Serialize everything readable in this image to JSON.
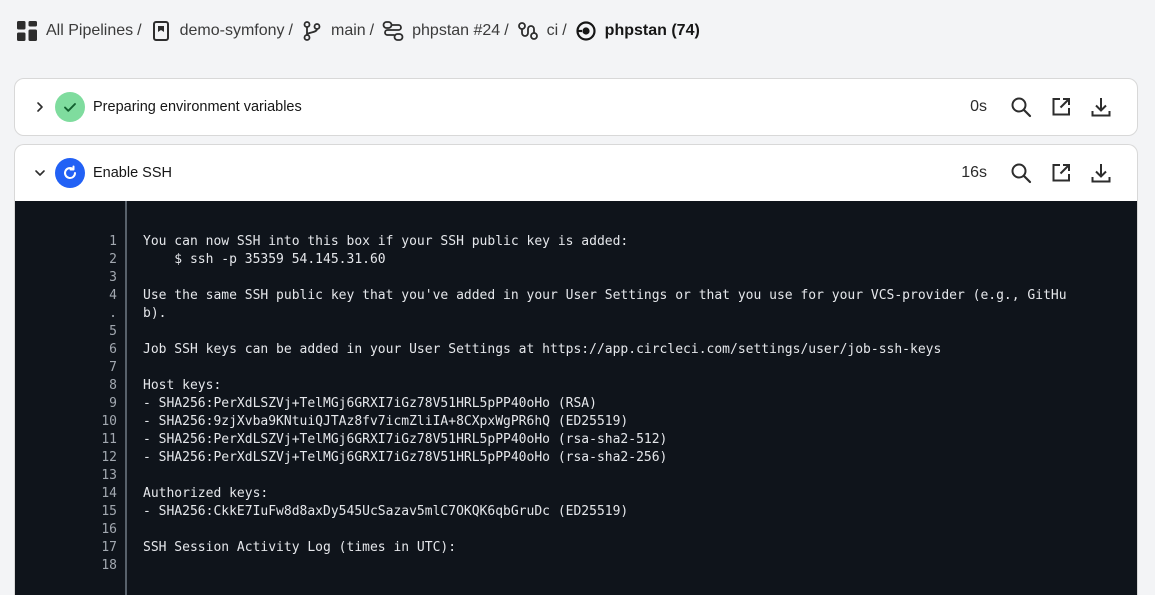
{
  "breadcrumb": {
    "items": [
      {
        "label": "All Pipelines",
        "sep": "/"
      },
      {
        "label": "demo-symfony",
        "sep": "/"
      },
      {
        "label": "main",
        "sep": "/"
      },
      {
        "label": "phpstan #24",
        "sep": "/"
      },
      {
        "label": "ci",
        "sep": "/"
      },
      {
        "label": "phpstan (74)"
      }
    ]
  },
  "steps": [
    {
      "title": "Preparing environment variables",
      "duration": "0s",
      "status": "success"
    },
    {
      "title": "Enable SSH",
      "duration": "16s",
      "status": "running"
    }
  ],
  "terminal": {
    "lines": [
      {
        "num": "1",
        "text": "You can now SSH into this box if your SSH public key is added:"
      },
      {
        "num": "2",
        "text": "    $ ssh -p 35359 54.145.31.60"
      },
      {
        "num": "3",
        "text": ""
      },
      {
        "num": "4",
        "text": "Use the same SSH public key that you've added in your User Settings or that you use for your VCS-provider (e.g., GitHu"
      },
      {
        "num": ".",
        "text": "b)."
      },
      {
        "num": "5",
        "text": ""
      },
      {
        "num": "6",
        "text": "Job SSH keys can be added in your User Settings at https://app.circleci.com/settings/user/job-ssh-keys"
      },
      {
        "num": "7",
        "text": ""
      },
      {
        "num": "8",
        "text": "Host keys:"
      },
      {
        "num": "9",
        "text": "- SHA256:PerXdLSZVj+TelMGj6GRXI7iGz78V51HRL5pPP40oHo (RSA)"
      },
      {
        "num": "10",
        "text": "- SHA256:9zjXvba9KNtuiQJTAz8fv7icmZliIA+8CXpxWgPR6hQ (ED25519)"
      },
      {
        "num": "11",
        "text": "- SHA256:PerXdLSZVj+TelMGj6GRXI7iGz78V51HRL5pPP40oHo (rsa-sha2-512)"
      },
      {
        "num": "12",
        "text": "- SHA256:PerXdLSZVj+TelMGj6GRXI7iGz78V51HRL5pPP40oHo (rsa-sha2-256)"
      },
      {
        "num": "13",
        "text": ""
      },
      {
        "num": "14",
        "text": "Authorized keys:"
      },
      {
        "num": "15",
        "text": "- SHA256:CkkE7IuFw8d8axDy545UcSazav5mlC7OKQK6qbGruDc (ED25519)"
      },
      {
        "num": "16",
        "text": ""
      },
      {
        "num": "17",
        "text": "SSH Session Activity Log (times in UTC):"
      },
      {
        "num": "18",
        "text": ""
      }
    ]
  },
  "icons": {
    "breadcrumb": [
      "grid-icon",
      "repo-icon",
      "branch-icon",
      "workflow-icon",
      "job-icon",
      "build-icon"
    ],
    "actions": [
      "search-icon",
      "external-link-icon",
      "download-icon"
    ]
  },
  "colors": {
    "success": "#7fdc9e",
    "running": "#2261f5",
    "terminal_bg": "#0f141b"
  }
}
